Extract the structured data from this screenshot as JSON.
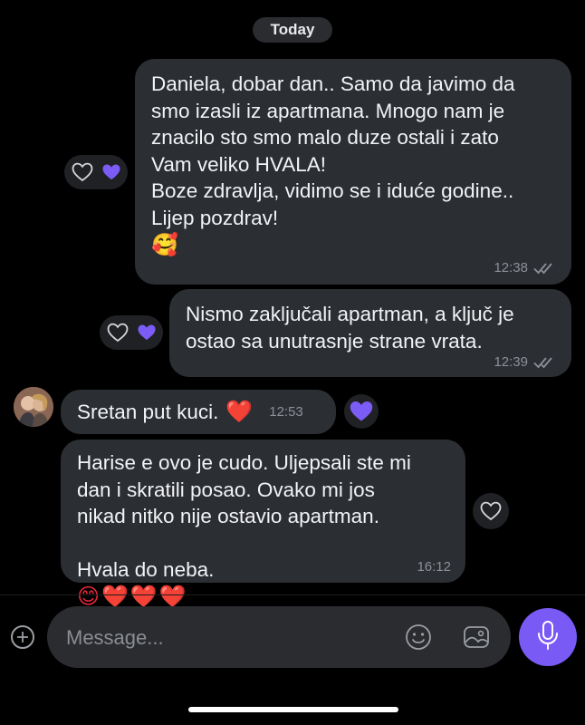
{
  "date_separator": "Today",
  "messages": [
    {
      "direction": "outgoing",
      "lines": "Daniela, dobar dan.. Samo da javimo da\nsmo izasli iz apartmana. Mnogo nam je\nznacilo sto smo malo duze ostali i zato\nVam veliko HVALA!\nBoze zdravlja, vidimo se i iduće godine..\nLijep pozdrav!",
      "emoji": "🥰",
      "time": "12:38",
      "status": "read"
    },
    {
      "direction": "outgoing",
      "lines": "Nismo zaključali apartman, a ključ je\nostao sa unutrasnje strane vrata.",
      "time": "12:39",
      "status": "read"
    },
    {
      "direction": "incoming",
      "text": "Sretan put kuci.",
      "emoji": "❤️",
      "time": "12:53",
      "reaction": "purple-heart"
    },
    {
      "direction": "incoming",
      "lines": "Harise e ovo je cudo. Uljepsali ste mi\ndan i skratili posao. Ovako mi jos\nnikad nitko nije ostavio apartman.",
      "last_line": "Hvala do neba.",
      "emojis": "😊❤️❤️❤️",
      "time": "16:12"
    }
  ],
  "composer": {
    "placeholder": "Message..."
  },
  "colors": {
    "background": "#000000",
    "bubble": "#2b2e33",
    "accent": "#7a5af5",
    "reaction_heart": "#7b5cf5"
  },
  "icons": [
    "heart-outline-icon",
    "purple-heart-icon",
    "add-icon",
    "emoji-icon",
    "gallery-icon",
    "microphone-icon",
    "read-checks-icon"
  ]
}
